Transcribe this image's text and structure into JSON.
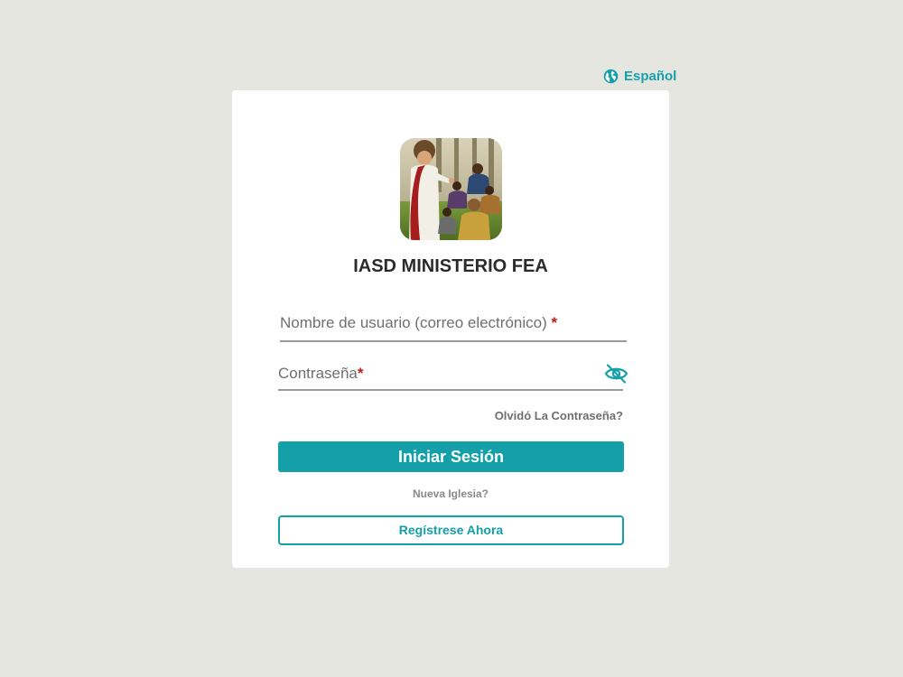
{
  "header": {
    "language_label": "Español",
    "language_icon": "globe-icon"
  },
  "brand": {
    "title": "IASD MINISTERIO FEA",
    "logo_icon": "ministry-logo"
  },
  "form": {
    "username_label": "Nombre de usuario (correo electrónico)",
    "password_label": "Contraseña",
    "required_marker": "*",
    "toggle_visibility_icon": "eye-off-icon",
    "forgot_password": "Olvidó La Contraseña?",
    "login_button": "Iniciar Sesión",
    "new_church_text": "Nueva Iglesia?",
    "register_button": "Regístrese Ahora"
  },
  "colors": {
    "accent": "#149fa9",
    "background": "#e6e6e1",
    "required": "#c21a1a"
  }
}
